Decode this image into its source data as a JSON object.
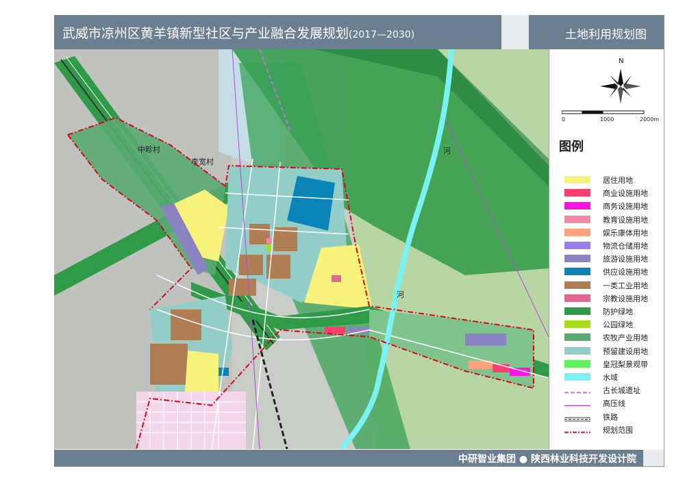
{
  "header": {
    "title": "武威市凉州区黄羊镇新型社区与产业融合发展规划",
    "years": "(2017—2030)",
    "subtitle": "土地利用规划图"
  },
  "map": {
    "labels": [
      {
        "name": "zhongling",
        "text": "中畛村"
      },
      {
        "name": "likuan",
        "text": "李宽村"
      },
      {
        "name": "river-1",
        "text": "河"
      },
      {
        "name": "river-2",
        "text": "河"
      }
    ],
    "colors": {
      "residential": "#f7f27a",
      "commercial": "#ff3d6e",
      "industrial": "#b07d55",
      "protective_green": "#2f9a47",
      "agri": "#5aaa72",
      "reserved": "#93cdc8",
      "water": "#7af2f2",
      "utility": "#0a84b7",
      "tourism": "#8c84c2",
      "boundary": "#e0001b"
    }
  },
  "compass": {
    "north": "N"
  },
  "scale": {
    "ticks": [
      "0",
      "1000",
      "2000m"
    ]
  },
  "legend": {
    "title": "图例",
    "items": [
      {
        "label": "居住用地",
        "color": "#f7f27a",
        "kind": "fill"
      },
      {
        "label": "商业设施用地",
        "color": "#ff3d6e",
        "kind": "fill"
      },
      {
        "label": "商务设施用地",
        "color": "#ff12e8",
        "kind": "fill"
      },
      {
        "label": "教育设施用地",
        "color": "#f08aa6",
        "kind": "fill"
      },
      {
        "label": "娱乐康体用地",
        "color": "#ffa27e",
        "kind": "fill"
      },
      {
        "label": "物流仓储用地",
        "color": "#9c7df0",
        "kind": "fill"
      },
      {
        "label": "旅游设施用地",
        "color": "#8c84c2",
        "kind": "fill"
      },
      {
        "label": "供应设施用地",
        "color": "#0a84b7",
        "kind": "fill"
      },
      {
        "label": "一类工业用地",
        "color": "#b07d55",
        "kind": "fill"
      },
      {
        "label": "宗教设施用地",
        "color": "#e0688c",
        "kind": "fill"
      },
      {
        "label": "防护绿地",
        "color": "#2f9a47",
        "kind": "fill"
      },
      {
        "label": "公园绿地",
        "color": "#a8dd1a",
        "kind": "fill"
      },
      {
        "label": "农牧产业用地",
        "color": "#5aaa72",
        "kind": "fill"
      },
      {
        "label": "预留建设用地",
        "color": "#93cdc8",
        "kind": "fill"
      },
      {
        "label": "皇冠梨景观带",
        "color": "#5ef25e",
        "kind": "fill"
      },
      {
        "label": "水域",
        "color": "#7af2f2",
        "kind": "fill"
      },
      {
        "label": "古长城遗址",
        "color": "#c56fe0",
        "kind": "dash"
      },
      {
        "label": "高压线",
        "color": "#b04ad6",
        "kind": "line"
      },
      {
        "label": "铁路",
        "color": "#333333",
        "kind": "rail"
      },
      {
        "label": "规划范围",
        "color": "#e0001b",
        "kind": "dashdot"
      }
    ]
  },
  "footer": {
    "org": "中研智业集团 ● 陕西林业科技开发设计院"
  }
}
